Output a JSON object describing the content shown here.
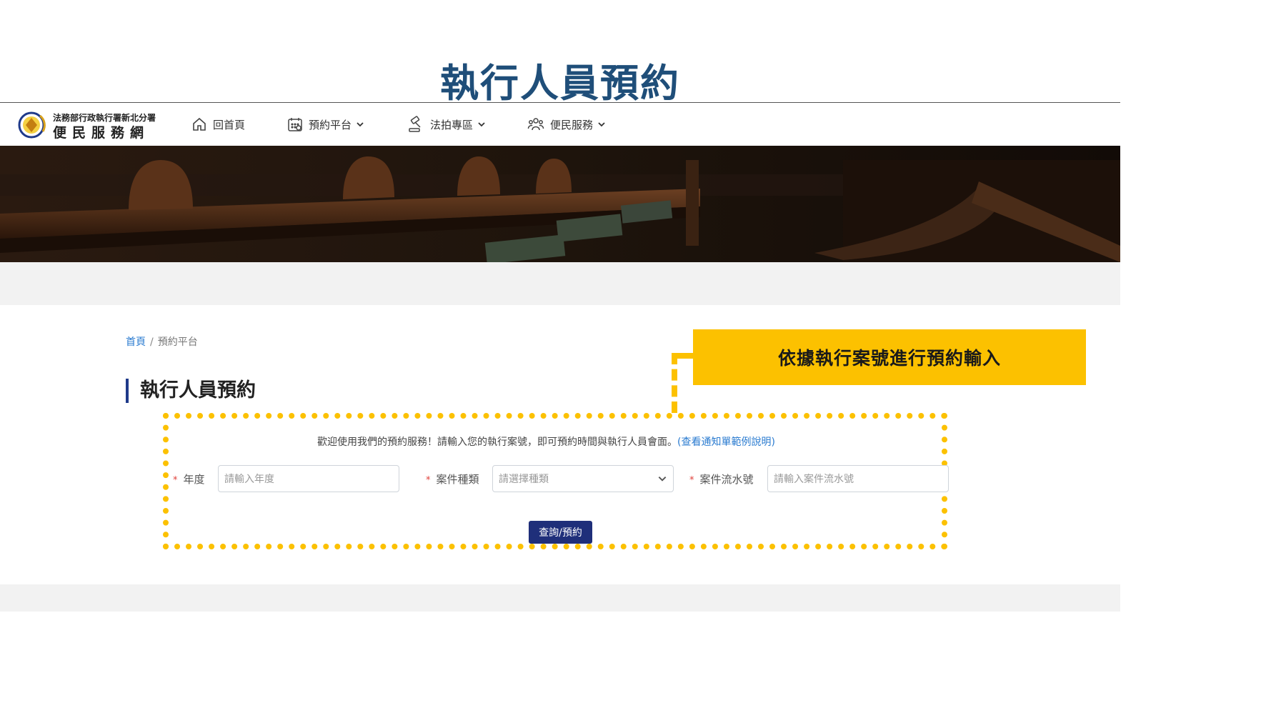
{
  "slide_title": "執行人員預約",
  "navbar": {
    "logo_small": "法務部行政執行署新北分署",
    "logo_big": "便民服務網",
    "items": [
      {
        "label": "回首頁",
        "icon": "home-icon",
        "has_dropdown": false
      },
      {
        "label": "預約平台",
        "icon": "calendar-icon",
        "has_dropdown": true
      },
      {
        "label": "法拍專區",
        "icon": "gavel-icon",
        "has_dropdown": true
      },
      {
        "label": "便民服務",
        "icon": "people-icon",
        "has_dropdown": true
      }
    ]
  },
  "breadcrumb": {
    "home": "首頁",
    "separator": "/",
    "current": "預約平台"
  },
  "page_heading": "執行人員預約",
  "callout": "依據執行案號進行預約輸入",
  "form": {
    "intro_text": "歡迎使用我們的預約服務！請輸入您的執行案號，即可預約時間與執行人員會面。",
    "intro_link": "(查看通知單範例說明)",
    "required_mark": "*",
    "fields": [
      {
        "label": "年度",
        "placeholder": "請輸入年度",
        "type": "text"
      },
      {
        "label": "案件種類",
        "placeholder": "請選擇種類",
        "type": "select"
      },
      {
        "label": "案件流水號",
        "placeholder": "請輸入案件流水號",
        "type": "text"
      }
    ],
    "submit_label": "查詢/預約"
  },
  "colors": {
    "title_blue": "#1f4e79",
    "highlight_yellow": "#fcc100",
    "button_navy": "#1f2f7a",
    "link_blue": "#2a7bd0",
    "required_red": "#e0403a"
  }
}
